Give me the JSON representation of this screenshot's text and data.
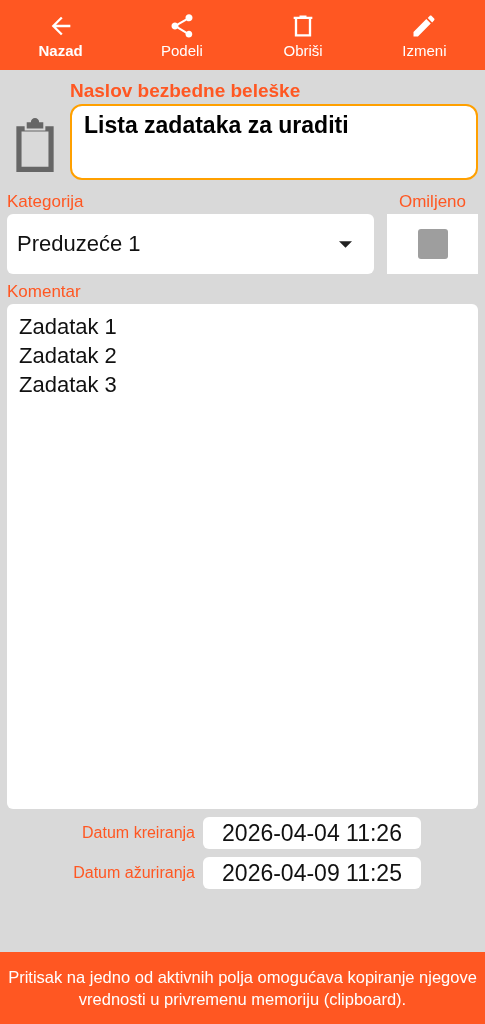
{
  "toolbar": [
    {
      "label": "Nazad",
      "kind": "back",
      "selected": true
    },
    {
      "label": "Podeli",
      "kind": "share",
      "selected": false
    },
    {
      "label": "Obriši",
      "kind": "delete",
      "selected": false
    },
    {
      "label": "Izmeni",
      "kind": "edit",
      "selected": false
    }
  ],
  "title": {
    "label": "Naslov bezbedne beleške",
    "value": "Lista zadataka za uraditi"
  },
  "category": {
    "label": "Kategorija",
    "value": "Preduzeće 1"
  },
  "favorite": {
    "label": "Omiljeno",
    "checked": false
  },
  "comment": {
    "label": "Komentar",
    "lines": [
      "Zadatak 1",
      "Zadatak 2",
      "Zadatak 3"
    ]
  },
  "dates": [
    {
      "label": "Datum kreiranja",
      "value": "2026-04-04 11:26"
    },
    {
      "label": "Datum ažuriranja",
      "value": "2026-04-09 11:25"
    }
  ],
  "footer": "Pritisak na jedno od aktivnih polja omogućava kopiranje njegove vrednosti u privremenu memoriju (clipboard)."
}
